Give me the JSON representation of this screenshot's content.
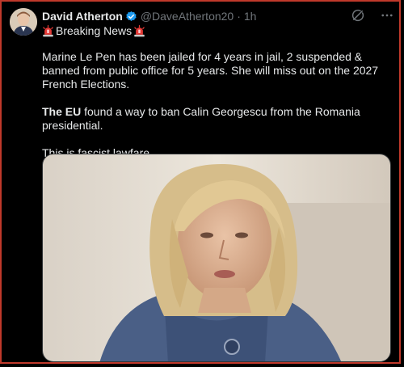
{
  "author": {
    "display_name": "David Atherton",
    "handle": "@DaveAtherton20",
    "time": "1h"
  },
  "post": {
    "heading": "Breaking News",
    "paragraph1": "Marine Le Pen has been jailed for 4 years in jail, 2 suspended & banned from public office for 5 years. She will miss out on the 2027 French Elections.",
    "paragraph2_bold": "The EU",
    "paragraph2_rest": " found a way to ban Calin Georgescu from the Romania presidential.",
    "paragraph3": "This is fascist lawfare."
  },
  "icons": {
    "verified": "verified-badge-icon",
    "siren": "police-light-icon",
    "grok": "grok-icon",
    "more": "more-icon"
  },
  "colors": {
    "background": "#000000",
    "text": "#e7e9ea",
    "secondary_text": "#71767b",
    "verified_blue": "#1d9bf0",
    "border_red": "#c0392b"
  }
}
